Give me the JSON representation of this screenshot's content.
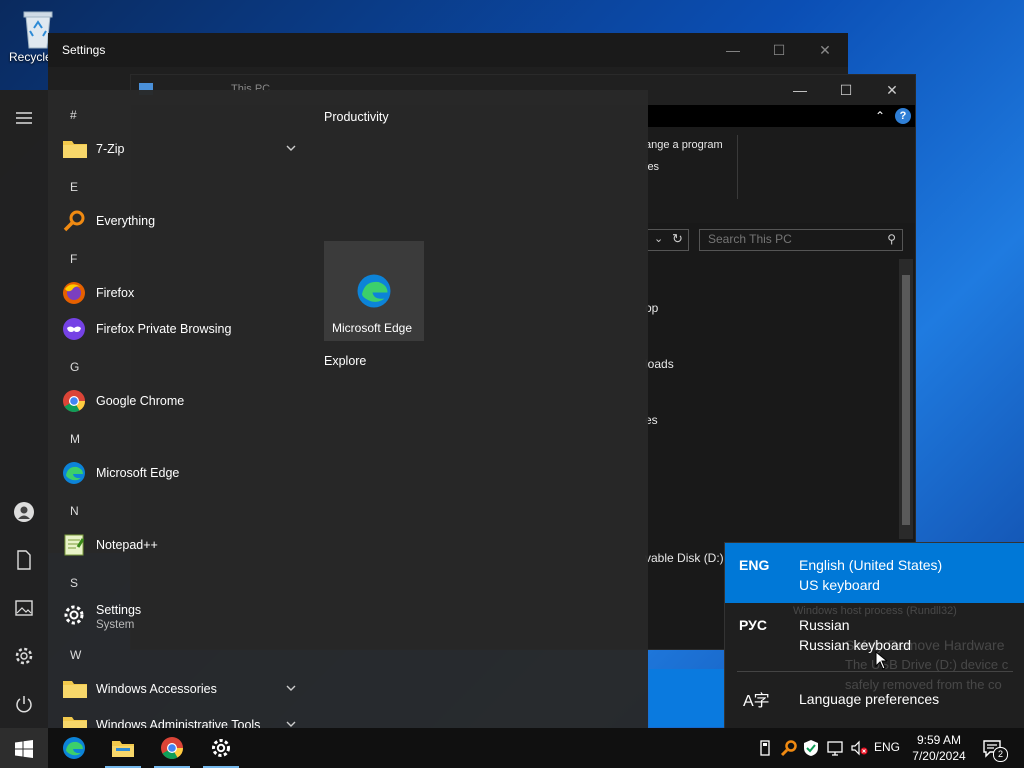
{
  "desktop": {
    "recycle_label": "Recycle"
  },
  "settings_window": {
    "title": "Settings"
  },
  "explorer": {
    "title": "This PC",
    "ribbon_text1": "ange a program",
    "ribbon_text2": "ies",
    "search_placeholder": "Search This PC",
    "side_items": [
      "op",
      "loads",
      "es"
    ],
    "drive_label": "vable Disk (D:)"
  },
  "start_menu": {
    "headers": [
      "#",
      "E",
      "F",
      "G",
      "M",
      "N",
      "S",
      "W"
    ],
    "apps": [
      {
        "name": "7-Zip"
      },
      {
        "name": "Everything"
      },
      {
        "name": "Firefox"
      },
      {
        "name": "Firefox Private Browsing"
      },
      {
        "name": "Google Chrome"
      },
      {
        "name": "Microsoft Edge"
      },
      {
        "name": "Notepad++"
      },
      {
        "name": "Settings",
        "sub": "System"
      },
      {
        "name": "Windows Accessories"
      },
      {
        "name": "Windows Administrative Tools"
      }
    ],
    "tiles_group": "Productivity",
    "tile_label": "Microsoft Edge",
    "explore_group": "Explore"
  },
  "language_flyout": {
    "items": [
      {
        "code": "ENG",
        "language": "English (United States)",
        "keyboard": "US keyboard"
      },
      {
        "code": "РУС",
        "language": "Russian",
        "keyboard": "Russian keyboard"
      }
    ],
    "preferences": "Language preferences",
    "ghost_notification": {
      "source": "Windows host process (Rundll32)",
      "title": "Safely Remove Hardware",
      "line1": "The USB Drive (D:) device c",
      "line2": "safely removed from the co"
    }
  },
  "taskbar": {
    "input_indicator": "ENG",
    "time": "9:59 AM",
    "date": "7/20/2024",
    "notification_count": "2"
  },
  "colors": {
    "accent": "#0078d7",
    "start_bg": "#2b2b2b",
    "taskbar_bg": "#101010",
    "highlight": "#76b9ed"
  }
}
